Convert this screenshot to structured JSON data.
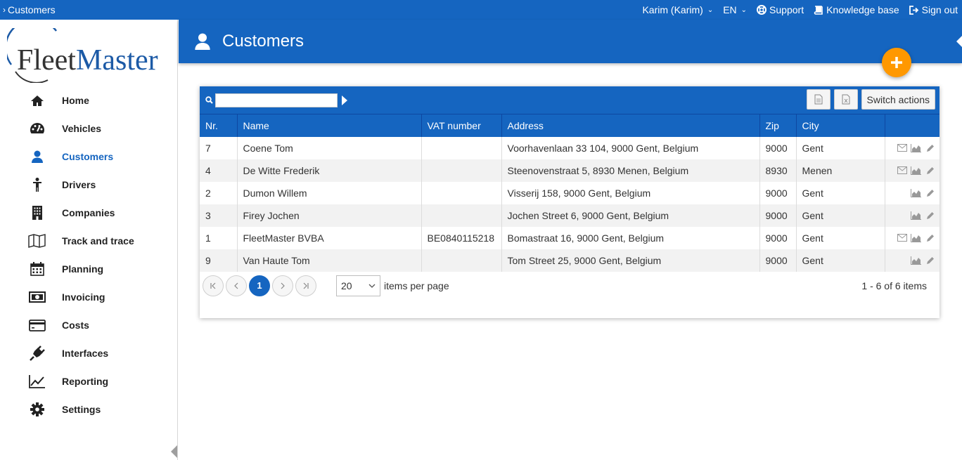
{
  "topbar": {
    "breadcrumb": "Customers",
    "user": "Karim (Karim)",
    "language": "EN",
    "support": "Support",
    "knowledge_base": "Knowledge base",
    "sign_out": "Sign out"
  },
  "sidebar": {
    "logo_a": "Fleet",
    "logo_b": "Master",
    "items": [
      {
        "label": "Home",
        "icon": "home-icon"
      },
      {
        "label": "Vehicles",
        "icon": "dashboard-icon"
      },
      {
        "label": "Customers",
        "icon": "user-icon",
        "active": true
      },
      {
        "label": "Drivers",
        "icon": "person-icon"
      },
      {
        "label": "Companies",
        "icon": "building-icon"
      },
      {
        "label": "Track and trace",
        "icon": "map-icon"
      },
      {
        "label": "Planning",
        "icon": "calendar-icon"
      },
      {
        "label": "Invoicing",
        "icon": "money-icon"
      },
      {
        "label": "Costs",
        "icon": "credit-card-icon"
      },
      {
        "label": "Interfaces",
        "icon": "plug-icon"
      },
      {
        "label": "Reporting",
        "icon": "line-chart-icon"
      },
      {
        "label": "Settings",
        "icon": "gear-icon"
      }
    ]
  },
  "header": {
    "title": "Customers"
  },
  "grid": {
    "search_value": "",
    "switch_actions": "Switch actions",
    "columns": [
      "Nr.",
      "Name",
      "VAT number",
      "Address",
      "Zip",
      "City",
      ""
    ],
    "rows": [
      {
        "nr": "7",
        "name": "Coene Tom",
        "vat": "",
        "address": "Voorhavenlaan 33 104, 9000 Gent, Belgium",
        "zip": "9000",
        "city": "Gent",
        "email": true
      },
      {
        "nr": "4",
        "name": "De Witte Frederik",
        "vat": "",
        "address": "Steenovenstraat 5, 8930 Menen, Belgium",
        "zip": "8930",
        "city": "Menen",
        "email": true
      },
      {
        "nr": "2",
        "name": "Dumon Willem",
        "vat": "",
        "address": "Visserij 158, 9000 Gent, Belgium",
        "zip": "9000",
        "city": "Gent",
        "email": false
      },
      {
        "nr": "3",
        "name": "Firey Jochen",
        "vat": "",
        "address": "Jochen Street 6, 9000 Gent, Belgium",
        "zip": "9000",
        "city": "Gent",
        "email": false
      },
      {
        "nr": "1",
        "name": "FleetMaster BVBA",
        "vat": "BE0840115218",
        "address": "Bomastraat 16, 9000 Gent, Belgium",
        "zip": "9000",
        "city": "Gent",
        "email": true
      },
      {
        "nr": "9",
        "name": "Van Haute Tom",
        "vat": "",
        "address": "Tom Street 25, 9000 Gent, Belgium",
        "zip": "9000",
        "city": "Gent",
        "email": false
      }
    ]
  },
  "pager": {
    "current_page": "1",
    "page_size": "20",
    "page_size_label": "items per page",
    "info": "1 - 6 of 6 items"
  },
  "colors": {
    "primary": "#1565c0",
    "accent": "#ff9800"
  }
}
